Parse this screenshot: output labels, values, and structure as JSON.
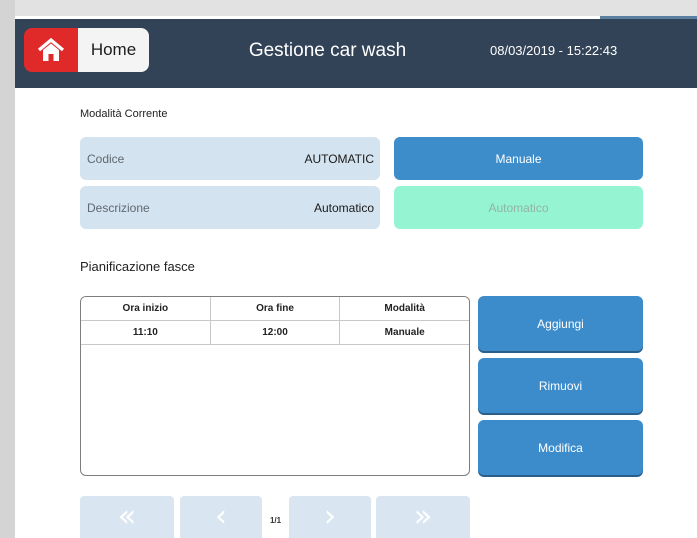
{
  "header": {
    "home_label": "Home",
    "title": "Gestione car wash",
    "datetime": "08/03/2019 - 15:22:43"
  },
  "current_mode": {
    "section_label": "Modalità Corrente",
    "code_key": "Codice",
    "code_value": "AUTOMATIC",
    "desc_key": "Descrizione",
    "desc_value": "Automatico",
    "manual_button": "Manuale",
    "automatic_button": "Automatico"
  },
  "schedule": {
    "section_label": "Pianificazione fasce",
    "columns": [
      "Ora inizio",
      "Ora fine",
      "Modalità"
    ],
    "rows": [
      [
        "11:10",
        "12:00",
        "Manuale"
      ]
    ],
    "add_button": "Aggiungi",
    "remove_button": "Rimuovi",
    "edit_button": "Modifica",
    "page_indicator": "1/1"
  },
  "icons": {
    "home": "home-icon",
    "first": "double-chevron-left-icon",
    "prev": "chevron-left-icon",
    "next": "chevron-right-icon",
    "last": "double-chevron-right-icon"
  },
  "colors": {
    "header_bg": "#334357",
    "home_red": "#e02a2a",
    "accent_blue": "#3c8ccb",
    "info_bg": "#d3e3ef",
    "auto_mint": "#95f5d3"
  }
}
